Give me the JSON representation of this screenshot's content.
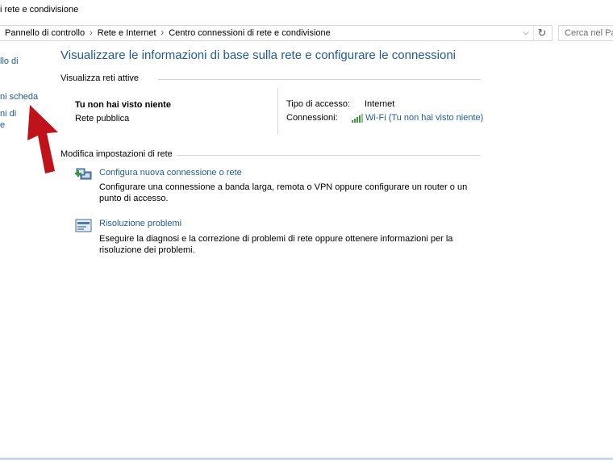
{
  "window": {
    "title": "i rete e condivisione"
  },
  "address": {
    "crumbs": [
      "Pannello di controllo",
      "Rete e Internet",
      "Centro connessioni di rete e condivisione"
    ],
    "chevron": "⌵",
    "refresh": "↻"
  },
  "search": {
    "placeholder": "Cerca nel Pan"
  },
  "leftnav": {
    "item1": "llo di",
    "item2": "ni scheda",
    "item3a": "ni di",
    "item3b": "e"
  },
  "main": {
    "title": "Visualizzare le informazioni di base sulla rete e configurare le connessioni",
    "active_networks_header": "Visualizza reti attive",
    "network": {
      "name": "Tu non hai visto niente",
      "category": "Rete pubblica",
      "access_type_label": "Tipo di accesso:",
      "access_type_value": "Internet",
      "connections_label": "Connessioni:",
      "connections_value": "Wi-Fi (Tu non hai visto niente)"
    },
    "settings_header": "Modifica impostazioni di rete",
    "tasks": [
      {
        "link": "Configura nuova connessione o rete",
        "description": "Configurare una connessione a banda larga, remota o VPN oppure configurare un router o un punto di accesso."
      },
      {
        "link": "Risoluzione problemi",
        "description": "Eseguire la diagnosi e la correzione di problemi di rete oppure ottenere informazioni per la risoluzione dei problemi."
      }
    ]
  },
  "colors": {
    "link": "#1e5c99",
    "arrow": "#c0121a"
  }
}
